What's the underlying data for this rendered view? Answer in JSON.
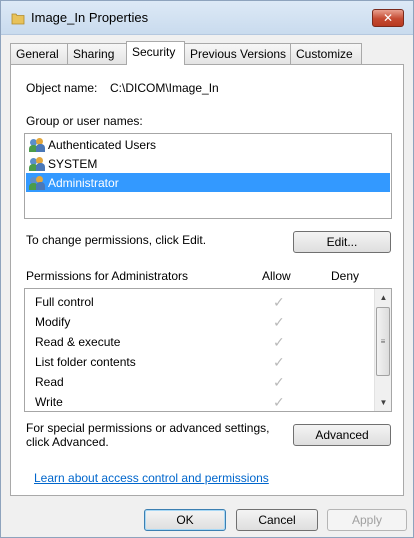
{
  "window": {
    "title": "Image_In Properties",
    "close_symbol": "✕"
  },
  "tabs": [
    {
      "label": "General"
    },
    {
      "label": "Sharing"
    },
    {
      "label": "Security"
    },
    {
      "label": "Previous Versions"
    },
    {
      "label": "Customize"
    }
  ],
  "security": {
    "object_name_label": "Object name:",
    "object_name_value": "C:\\DICOM\\Image_In",
    "group_label": "Group or user names:",
    "users": [
      {
        "name": "Authenticated Users"
      },
      {
        "name": "SYSTEM"
      },
      {
        "name": "Administrator"
      }
    ],
    "change_text": "To change permissions, click Edit.",
    "edit_label": "Edit...",
    "permissions_for": "Permissions for Administrators",
    "allow_header": "Allow",
    "deny_header": "Deny",
    "permissions": [
      {
        "name": "Full control",
        "allow": true,
        "deny": false
      },
      {
        "name": "Modify",
        "allow": true,
        "deny": false
      },
      {
        "name": "Read & execute",
        "allow": true,
        "deny": false
      },
      {
        "name": "List folder contents",
        "allow": true,
        "deny": false
      },
      {
        "name": "Read",
        "allow": true,
        "deny": false
      },
      {
        "name": "Write",
        "allow": true,
        "deny": false
      }
    ],
    "special_line1": "For special permissions or advanced settings,",
    "special_line2": "click Advanced.",
    "advanced_label": "Advanced",
    "learn_link": "Learn about access control and permissions"
  },
  "footer": {
    "ok_label": "OK",
    "cancel_label": "Cancel",
    "apply_label": "Apply"
  },
  "colors": {
    "selection": "#3399ff",
    "link": "#0066cc"
  }
}
